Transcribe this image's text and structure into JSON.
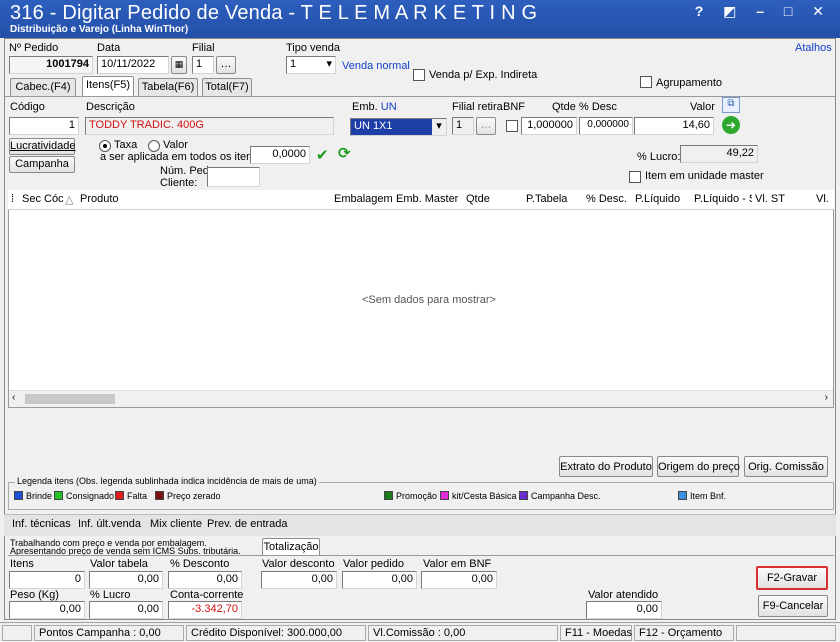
{
  "window": {
    "title": "316 - Digitar Pedido de Venda - T E L E M A R K E T I N G",
    "subtitle": "Distribuição e Varejo (Linha WinThor)",
    "controls": "? ◩ – □ ✕"
  },
  "header": {
    "num_pedido_label": "Nº Pedido",
    "num_pedido_value": "1001794",
    "data_label": "Data",
    "data_value": "10/11/2022",
    "filial_label": "Filial",
    "filial_value": "1",
    "tipo_venda_label": "Tipo venda",
    "tipo_venda_value": "1",
    "tipo_venda_desc": "Venda normal",
    "venda_exp_label": "Venda p/ Exp. Indireta",
    "agrupamento_label": "Agrupamento",
    "atalhos_label": "Atalhos"
  },
  "tabs": [
    {
      "label": "Cabec.(F4)"
    },
    {
      "label": "Itens(F5)"
    },
    {
      "label": "Tabela(F6)"
    },
    {
      "label": "Total(F7)"
    }
  ],
  "item": {
    "codigo_label": "Código",
    "codigo_value": "1",
    "descricao_label": "Descrição",
    "descricao_value": "TODDY TRADIC. 400G",
    "emb_label": "Emb.",
    "emb_un": "UN",
    "emb_value": "UN 1X1",
    "filial_retira_label": "Filial retira",
    "filial_retira_value": "1",
    "bnf_label": "BNF",
    "qtde_label": "Qtde",
    "qtde_value": "1,000000",
    "desc_label": "% Desc",
    "desc_value": "0,000000",
    "valor_label": "Valor",
    "valor_value": "14,60",
    "lucratividade_label": "Lucratividade",
    "campanha_label": "Campanha",
    "taxa_label": "Taxa",
    "valor_radio_label": "Valor",
    "aplicada_label": "a ser aplicada em todos os itens:",
    "aplicada_value": "0,0000",
    "num_ped_label": "Núm. Ped.",
    "cliente_label": "Cliente:",
    "lucro_label": "% Lucro:",
    "lucro_value": "49,22",
    "item_master_label": "Item em unidade master"
  },
  "grid": {
    "columns": [
      "Sec",
      "Cóc",
      "Produto",
      "Embalagem",
      "Emb. Master",
      "Qtde",
      "P.Tabela",
      "% Desc.",
      "P.Líquido",
      "P.Líquido - S",
      "Vl. ST",
      "Vl."
    ],
    "empty_text": "<Sem dados para mostrar>"
  },
  "actions": {
    "extrato": "Extrato do Produto",
    "origem": "Origem do preço",
    "comissao": "Orig. Comissão"
  },
  "legend": {
    "title": "Legenda itens (Obs. legenda sublinhada indica incidência de mais de uma)",
    "items": [
      {
        "label": "Brinde",
        "color": "#1f4fd6"
      },
      {
        "label": "Consignado",
        "color": "#22c322"
      },
      {
        "label": "Falta",
        "color": "#e01b1b"
      },
      {
        "label": "Preço zerado",
        "color": "#7a1010"
      },
      {
        "label": "Promoção",
        "color": "#1a7a1a"
      },
      {
        "label": "kit/Cesta Básica",
        "color": "#e02bd8"
      },
      {
        "label": "Campanha Desc.",
        "color": "#6a2bd0"
      },
      {
        "label": "Item Bnf.",
        "color": "#3b8fe0"
      }
    ]
  },
  "bottom_tabs": [
    "Inf. técnicas",
    "Inf. últ.venda",
    "Mix cliente",
    "Prev. de entrada"
  ],
  "notes": {
    "line1": "Trabalhando com preço e venda por embalagem.",
    "line2": "Apresentando preço de venda sem ICMS Subs. tributária.",
    "totalizacao_tab": "Totalização"
  },
  "totals": {
    "itens_label": "Itens",
    "itens_value": "0",
    "valor_tabela_label": "Valor tabela",
    "valor_tabela_value": "0,00",
    "desconto_label": "% Desconto",
    "desconto_value": "0,00",
    "valor_desconto_label": "Valor desconto",
    "valor_desconto_value": "0,00",
    "valor_pedido_label": "Valor pedido",
    "valor_pedido_value": "0,00",
    "valor_bnf_label": "Valor em BNF",
    "valor_bnf_value": "0,00",
    "peso_label": "Peso (Kg)",
    "peso_value": "0,00",
    "lucro_label": "% Lucro",
    "lucro_value": "0,00",
    "conta_label": "Conta-corrente",
    "conta_value": "-3.342,70",
    "atendido_label": "Valor atendido",
    "atendido_value": "0,00"
  },
  "buttons": {
    "gravar": "F2-Gravar",
    "cancelar": "F9-Cancelar"
  },
  "status": {
    "pontos": "Pontos Campanha : 0,00",
    "credito": "Crédito Disponível: 300.000,00",
    "comissao": "Vl.Comissão : 0,00",
    "moedas": "F11 - Moedas",
    "orcamento": "F12 - Orçamento"
  }
}
